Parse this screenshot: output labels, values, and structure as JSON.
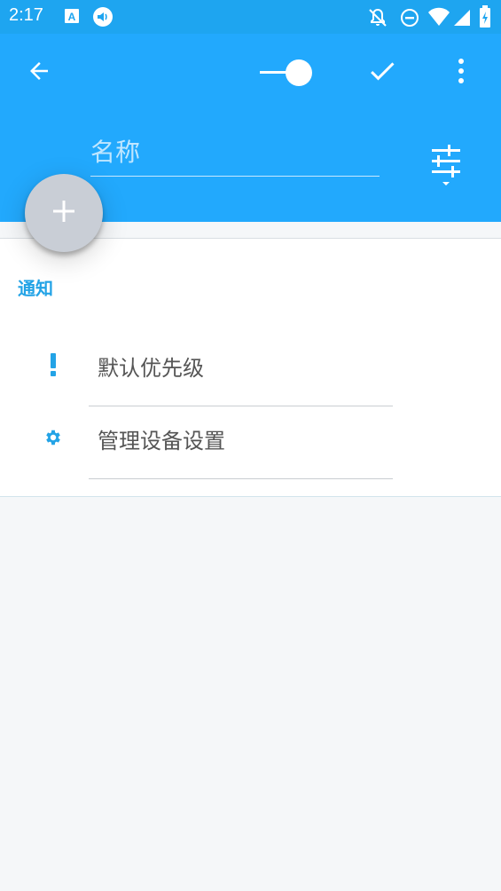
{
  "status_bar": {
    "time": "2:17",
    "left_icons": [
      "text-a-icon",
      "volume-icon"
    ],
    "right_icons": [
      "notifications-off-icon",
      "do-not-disturb-icon",
      "wifi-icon",
      "signal-icon",
      "battery-icon"
    ]
  },
  "toolbar": {
    "back_icon": "arrow-back-icon",
    "toggle_state": "on",
    "confirm_icon": "check-icon",
    "more_icon": "more-vert-icon"
  },
  "name_field": {
    "placeholder": "名称",
    "value": ""
  },
  "tune_icon": "tune-sliders-icon",
  "fab_icon": "add-icon",
  "notifications": {
    "title": "通知",
    "items": [
      {
        "label": "默认优先级",
        "icon": "priority-exclamation-icon"
      },
      {
        "label": "管理设备设置",
        "icon": "settings-gear-icon"
      }
    ]
  },
  "colors": {
    "appbar": "#22a9fd",
    "statusbar": "#1ea5f0",
    "accent": "#23a3e6",
    "fab": "#c9ced6",
    "background": "#f5f7f9"
  }
}
